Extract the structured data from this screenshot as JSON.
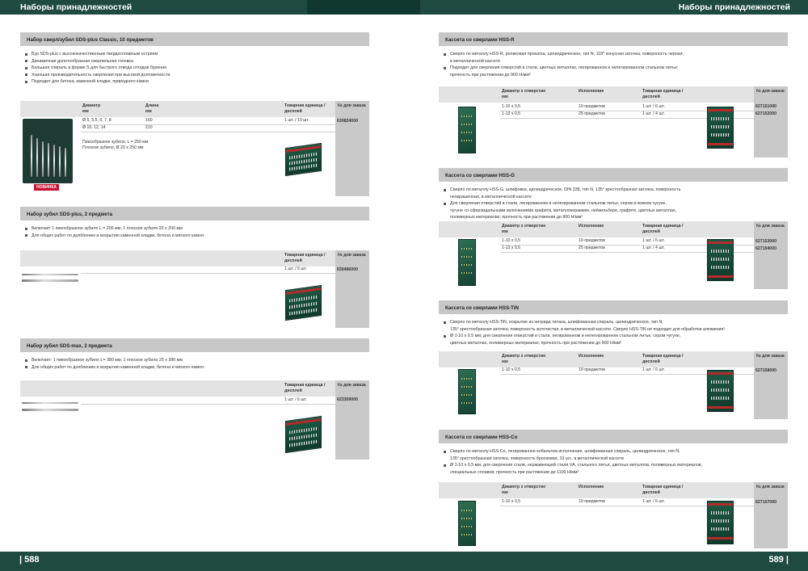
{
  "header": {
    "left_title": "Наборы принадлежностей",
    "right_title": "Наборы принадлежностей"
  },
  "footer": {
    "left_page": "| 588",
    "right_page": "589 |"
  },
  "left": {
    "b1": {
      "title": "Набор сверл/зубил SDS-plus Classic, 10 предметов",
      "bullets": [
        "Бур SDS-plus с высококачественным твердосплавным острием",
        "Динамичная долотообразная сверлильная головка",
        "Большая спираль в форме S для быстрого отвода отходов бурения",
        "Хорошая производительность сверления при высокой долговечности",
        "Подходит для бетона, каменной кладки, природного камня"
      ],
      "col_diam": "Диаметр\nмм",
      "col_len": "Длина\nмм",
      "col_unit": "Товарная единица /\nдисплей",
      "col_order": "№ для заказа",
      "rows": [
        {
          "diam": "Ø 5, 5,5, 6, 7, 8",
          "len": "160",
          "unit": "1 шт. / 10 шт.",
          "order": "630824000"
        },
        {
          "diam": "Ø 10, 12, 14",
          "len": "210",
          "unit": "",
          "order": ""
        }
      ],
      "note1": "Пикообразное зубило, L = 250 мм",
      "note2": "Плоское зубило, Ø 20 x 250 мм",
      "badge": "НОВИНКА"
    },
    "b2": {
      "title": "Набор зубил SDS-plus, 2 предмета",
      "bullets": [
        "Включает 1 пикообразное зубило L = 200 мм, 1 плоское зубило 20 x 200 мм",
        "Для общих работ по долблению и вскрытию каменной кладки, бетона и мягкого камня."
      ],
      "col_unit": "Товарная единица /\nдисплей",
      "col_order": "№ для заказа",
      "unit": "1 шт. / 6 шт.",
      "order": "630486000"
    },
    "b3": {
      "title": "Набор зубил SDS-max, 2 предмета",
      "bullets": [
        "Включает: 1 пикообразное зубило L= 380 мм, 1 плоское зубило 25 x 380 мм",
        "Для общих работ по долблению и вскрытию каменной кладки, бетона и мягкого камня."
      ],
      "col_unit": "Товарная единица /\nдисплей",
      "col_order": "№ для заказа",
      "unit": "1 шт. / 6 шт.",
      "order": "623309000"
    }
  },
  "right": {
    "col_diam": "Диаметр x отверстие\nмм",
    "col_exec": "Исполнение",
    "col_unit": "Товарная единица /\nдисплей",
    "col_order": "№ для заказа",
    "r1": {
      "title": "Кассета со сверлами HSS-R",
      "bullets": [
        "Сверло по металлу HSS-R, роликовая прокатка, цилиндрическое, тип N, 118° конусная заточка, поверхность черная,\nв металлической кассете",
        "Подходит для сверления отверстий в стали, цветных металлах, легированном и нелегированном стальном литье;\nпрочность при растяжении до 900 Н/мм²"
      ],
      "rows": [
        {
          "diam": "1-10 x 0,5",
          "exec": "19 предметов",
          "unit": "1 шт. / 6 шт.",
          "order": "627151000"
        },
        {
          "diam": "1-13 x 0,5",
          "exec": "25 предметов",
          "unit": "1 шт. / 4 шт.",
          "order": "627152000"
        }
      ]
    },
    "r2": {
      "title": "Кассета со сверлами HSS-G",
      "bullets": [
        "Сверло по металлу HSS-G, шлифовка, цилиндрическое, DIN 338, тип N, 135° крестообразная заточка, поверхность\nнеокрашенная, в металлической кассете",
        "Для сверления отверстий в стали, легированном и нелегированном стальном литье, сером и ковком чугуне,\nчугуне со сфероидальными включениями графита, металлокерамике, нейзильбере, графите, цветных металлах,\nполимерных материалах; прочность при растяжении до 900 Н/мм²"
      ],
      "rows": [
        {
          "diam": "1-10 x 0,5",
          "exec": "19 предметов",
          "unit": "1 шт. / 6 шт.",
          "order": "627153000"
        },
        {
          "diam": "1-13 x 0,5",
          "exec": "25 предметов",
          "unit": "1 шт. / 4 шт.",
          "order": "627154000"
        }
      ]
    },
    "r3": {
      "title": "Кассета со сверлами HSS-TiN",
      "bullets": [
        "Сверло по металлу HSS-TiN, покрытие из нитрида титана, шлифованная спираль, цилиндрическое, тип N,\n135° крестообразная заточка, поверхность золотистая, в металлической кассете. Сверло HSS-TiN не подходит для обработки алюминия!",
        "Ø 1-10 x 0,5 мм; для сверления отверстий в стали, легированном и нелегированном стальном литье, сером чугуне,\nцветных металлах, полимерных материалах; прочность при растяжении до 900 Н/мм²"
      ],
      "rows": [
        {
          "diam": "1-10 x 0,5",
          "exec": "19 предметов",
          "unit": "1 шт. / 6 шт.",
          "order": "627158000"
        }
      ]
    },
    "r4": {
      "title": "Кассета со сверлами HSS-Co",
      "bullets": [
        "Сверло по металлу HSS-Co, легированное кобальтом исполнение, шлифованная спираль, цилиндрическое, тип N,\n135° крестообразная заточка, поверхность бронзовая, 19 шт., в металлической кассете",
        "Ø 1-10 x 0,5 мм; для сверления стали, нержавеющей стали VA, стального литья, цветных металлов, полимерных материалов,\nспециальных сплавов; прочность при растяжении до 1100 Н/мм²"
      ],
      "rows": [
        {
          "diam": "1-10 x 0,5",
          "exec": "19 предметов",
          "unit": "1 шт. / 6 шт.",
          "order": "627157000"
        }
      ]
    }
  }
}
